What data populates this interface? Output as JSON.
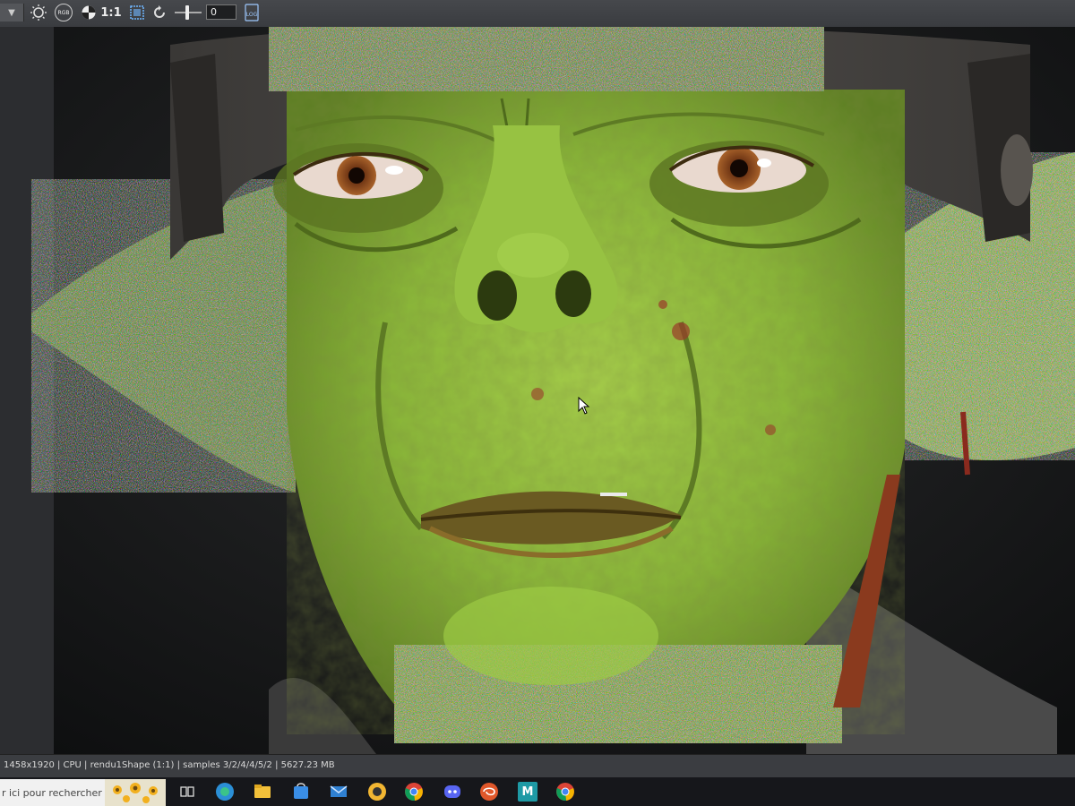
{
  "toolbar": {
    "dropdown_icon": "chevron-down-icon",
    "exposure_icon": "sun-exposure-icon",
    "rgb_label": "RGB",
    "channel_icon": "channel-display-icon",
    "ratio_label": "1:1",
    "region_icon": "render-region-icon",
    "refresh_icon": "refresh-icon",
    "exposure_value": "0",
    "log_label": "LOG"
  },
  "viewport": {
    "image": "rendered goblin face close-up, green skin, brown eyes, leather helmet, partially noisy buckets"
  },
  "status_bar": {
    "text": "1458x1920 | CPU | rendu1Shape (1:1) | samples 3/2/4/4/5/2 | 5627.23 MB"
  },
  "taskbar": {
    "search_placeholder": "r ici pour rechercher",
    "apps": [
      {
        "name": "task-view-icon"
      },
      {
        "name": "edge-icon",
        "color": "#2b8fd6"
      },
      {
        "name": "file-explorer-icon",
        "color": "#f3c13a"
      },
      {
        "name": "store-icon",
        "color": "#3a8ee6"
      },
      {
        "name": "mail-icon",
        "color": "#2f80d1"
      },
      {
        "name": "app-icon",
        "color": "#f2b632"
      },
      {
        "name": "chrome-icon",
        "color": "#db4437"
      },
      {
        "name": "discord-icon",
        "color": "#5865f2"
      },
      {
        "name": "houdini-icon",
        "color": "#e0572a"
      },
      {
        "name": "maya-icon",
        "color": "#1e9aa5",
        "label": "M"
      },
      {
        "name": "chrome-profile-icon",
        "color": "#db4437"
      }
    ]
  },
  "colors": {
    "skin": "#8fbe3a",
    "toolbar": "#3f4145",
    "status_bar": "#3b3d41",
    "taskbar": "#16171b"
  }
}
